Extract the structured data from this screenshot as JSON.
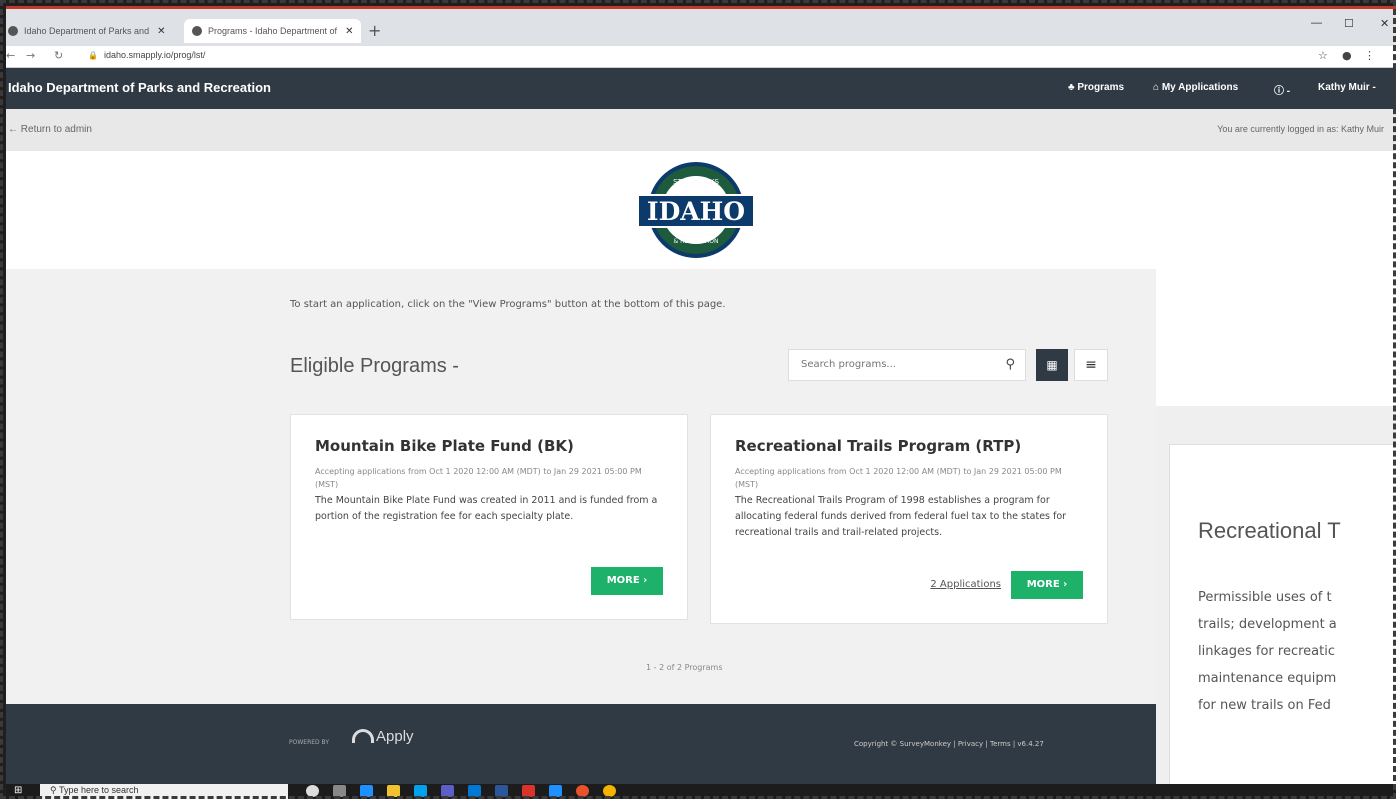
{
  "browser": {
    "tabs": [
      {
        "label": "Idaho Department of Parks and",
        "active": false
      },
      {
        "label": "Programs - Idaho Department of",
        "active": true
      }
    ],
    "url": "idaho.smapply.io/prog/lst/"
  },
  "header": {
    "site_title": "Idaho Department of Parks and Recreation",
    "nav": {
      "programs": "Programs",
      "my_applications": "My Applications",
      "info": "-",
      "user": "Kathy Muir -"
    }
  },
  "adminbar": {
    "return_label": "Return to admin",
    "logged_in": "You are currently logged in as: Kathy Muir"
  },
  "logo": {
    "top_text": "STATE PARKS",
    "main_text": "IDAHO",
    "bottom_text": "& RECREATION"
  },
  "main": {
    "intro": "To start an application, click on the \"View Programs\" button at the bottom of this page.",
    "section_title": "Eligible Programs -",
    "search_placeholder": "Search programs...",
    "pagination": "1 - 2 of 2 Programs"
  },
  "cards": [
    {
      "title": "Mountain Bike Plate Fund (BK)",
      "dates": "Accepting applications from Oct 1 2020 12:00 AM (MDT) to Jan 29 2021 05:00 PM (MST)",
      "description": "The Mountain Bike Plate Fund was created in 2011 and is funded from a portion of the registration fee for each specialty plate.",
      "more": "MORE ›"
    },
    {
      "title": "Recreational Trails Program (RTP)",
      "dates": "Accepting applications from Oct 1 2020 12:00 AM (MDT) to Jan 29 2021 05:00 PM (MST)",
      "description": "The Recreational Trails Program of 1998 establishes a program for allocating federal funds derived from federal fuel tax to the states for recreational trails and trail-related projects.",
      "applications": "2 Applications",
      "more": "MORE ›"
    }
  ],
  "right_panel": {
    "title": "Recreational T",
    "lines": [
      "Permissible uses of t",
      "trails; development a",
      "linkages for recreatic",
      "maintenance equipm",
      "for new trails on Fed"
    ]
  },
  "footer": {
    "powered_by": "POWERED BY",
    "apply": "Apply",
    "copyright": "Copyright © SurveyMonkey | Privacy | Terms | v6.4.27"
  },
  "taskbar": {
    "search_placeholder": "Type here to search"
  },
  "colors": {
    "header_bg": "#2f3a45",
    "button_green": "#1db16a",
    "logo_green": "#1e5a3c",
    "logo_blue": "#0b3a6b"
  }
}
